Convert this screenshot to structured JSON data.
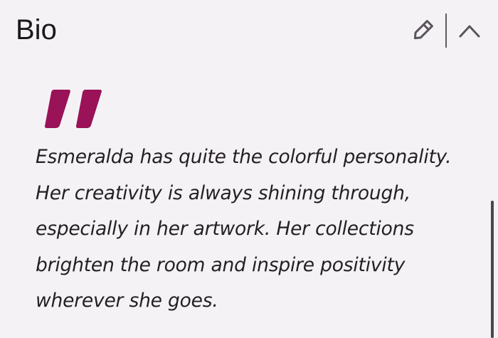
{
  "section": {
    "title": "Bio"
  },
  "actions": {
    "edit_icon": "pencil-icon",
    "collapse_icon": "chevron-up-icon"
  },
  "quote": {
    "icon": "quote-mark-icon",
    "color": "#9a1258",
    "lines": [
      "Esmeralda has quite the colorful personality.",
      "Her creativity is always shining through,",
      "especially in her artwork. Her collections",
      "brighten the room and inspire positivity",
      "wherever she goes."
    ]
  }
}
